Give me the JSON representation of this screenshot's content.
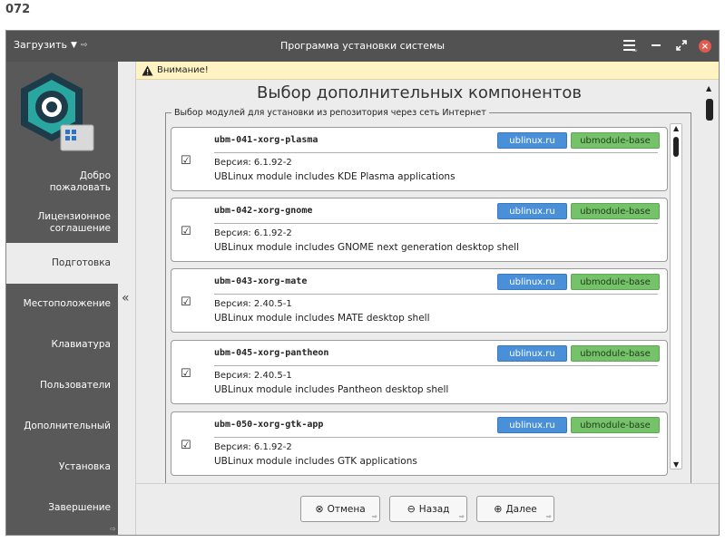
{
  "frame_label": "072",
  "titlebar": {
    "load_label": "Загрузить",
    "title": "Программа установки системы",
    "menu_icon": "hamburger-icon",
    "minimize_icon": "minimize-icon",
    "maximize_icon": "maximize-icon",
    "close_icon": "close-icon"
  },
  "sidebar": {
    "items": [
      {
        "label": "Добро\nпожаловать",
        "active": false
      },
      {
        "label": "Лицензионное\nсоглашение",
        "active": false
      },
      {
        "label": "Подготовка",
        "active": true
      },
      {
        "label": "Местоположение",
        "active": false
      },
      {
        "label": "Клавиатура",
        "active": false
      },
      {
        "label": "Пользователи",
        "active": false
      },
      {
        "label": "Дополнительный",
        "active": false
      },
      {
        "label": "Установка",
        "active": false
      },
      {
        "label": "Завершение",
        "active": false
      }
    ],
    "collapse_glyph": "«"
  },
  "warning": {
    "text": "Внимание!"
  },
  "page": {
    "title": "Выбор дополнительных компонентов",
    "group_legend": "Выбор модулей для установки из репозитория через сеть Интернет"
  },
  "modules": [
    {
      "name": "ubm-041-xorg-plasma",
      "version": "Версия: 6.1.92-2",
      "description": "UBLinux module includes KDE Plasma applications",
      "repo": "ublinux.ru",
      "base": "ubmodule-base",
      "checked": true
    },
    {
      "name": "ubm-042-xorg-gnome",
      "version": "Версия: 6.1.92-2",
      "description": "UBLinux module includes GNOME next generation desktop shell",
      "repo": "ublinux.ru",
      "base": "ubmodule-base",
      "checked": true
    },
    {
      "name": "ubm-043-xorg-mate",
      "version": "Версия: 2.40.5-1",
      "description": "UBLinux module includes MATE desktop shell",
      "repo": "ublinux.ru",
      "base": "ubmodule-base",
      "checked": true
    },
    {
      "name": "ubm-045-xorg-pantheon",
      "version": "Версия: 2.40.5-1",
      "description": "UBLinux module includes Pantheon desktop shell",
      "repo": "ublinux.ru",
      "base": "ubmodule-base",
      "checked": true
    },
    {
      "name": "ubm-050-xorg-gtk-app",
      "version": "Версия: 6.1.92-2",
      "description": "UBLinux module includes GTK applications",
      "repo": "ublinux.ru",
      "base": "ubmodule-base",
      "checked": true
    }
  ],
  "buttons": {
    "cancel": "Отмена",
    "back": "Назад",
    "next": "Далее"
  },
  "colors": {
    "titlebar": "#525252",
    "sidebar": "#595959",
    "repo_tag": "#4a90d9",
    "base_tag": "#76c26b",
    "warning_bg": "#fff3c4",
    "close": "#e05a4f"
  }
}
